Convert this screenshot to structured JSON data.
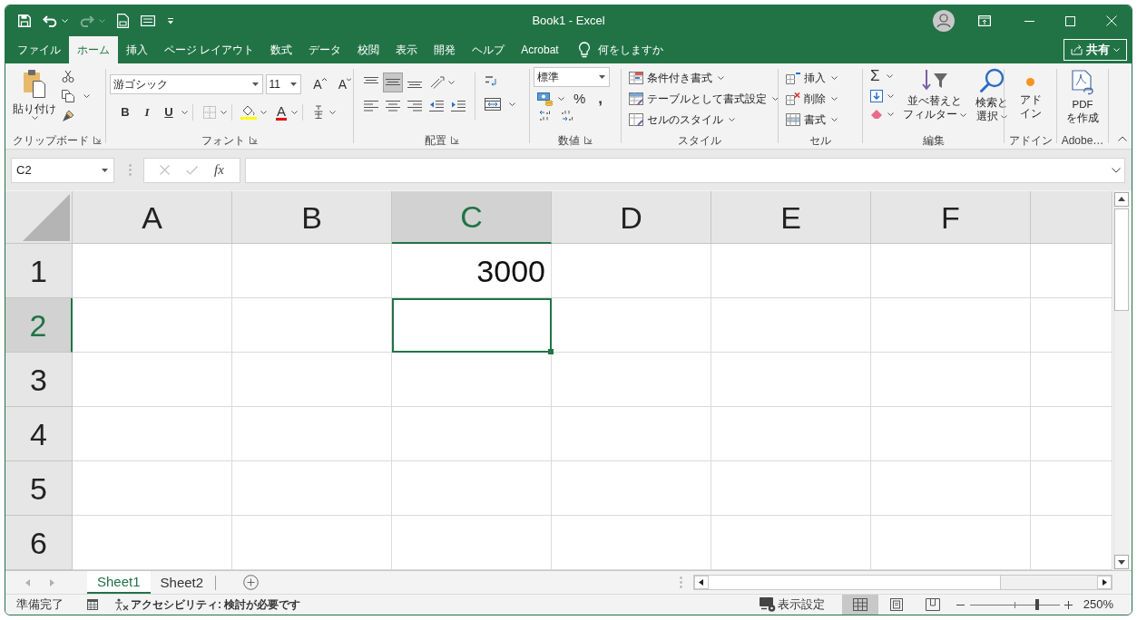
{
  "title_bar": {
    "quick_access": [
      {
        "kind": "save",
        "disabled": false
      },
      {
        "kind": "undo",
        "disabled": false
      },
      {
        "kind": "redo",
        "disabled": true
      },
      {
        "kind": "print_preview",
        "disabled": false
      },
      {
        "kind": "form",
        "disabled": false
      },
      {
        "kind": "customize",
        "disabled": false
      }
    ],
    "title": "Book1 - Excel"
  },
  "menu_tabs": [
    {
      "label": "ファイル",
      "selected": false
    },
    {
      "label": "ホーム",
      "selected": true
    },
    {
      "label": "挿入",
      "selected": false
    },
    {
      "label": "ページ レイアウト",
      "selected": false
    },
    {
      "label": "数式",
      "selected": false
    },
    {
      "label": "データ",
      "selected": false
    },
    {
      "label": "校閲",
      "selected": false
    },
    {
      "label": "表示",
      "selected": false
    },
    {
      "label": "開発",
      "selected": false
    },
    {
      "label": "ヘルプ",
      "selected": false
    },
    {
      "label": "Acrobat",
      "selected": false
    }
  ],
  "tell_me": {
    "text": "何をしますか"
  },
  "share_button": {
    "label": "共有"
  },
  "ribbon": {
    "groups": [
      {
        "kind": "clipboard",
        "label": "クリップボード",
        "launcher": true,
        "paste_label": "貼り付け"
      },
      {
        "kind": "font",
        "label": "フォント",
        "launcher": true,
        "font_name": "游ゴシック",
        "font_size": "11",
        "grow_label": "A",
        "shrink_label": "A",
        "style_buttons": [
          "B",
          "I",
          "U"
        ],
        "color_label": "A"
      },
      {
        "kind": "alignment",
        "label": "配置",
        "launcher": true,
        "vertical": [
          {
            "selected": false
          },
          {
            "selected": true
          },
          {
            "selected": false
          }
        ]
      },
      {
        "kind": "number",
        "label": "数値",
        "launcher": true,
        "format": "標準",
        "percent": "%",
        "comma": ","
      },
      {
        "kind": "styles",
        "label": "スタイル",
        "commands": [
          {
            "kind": "conditional",
            "label": "条件付き書式"
          },
          {
            "kind": "table",
            "label": "テーブルとして書式設定"
          },
          {
            "kind": "cell_styles",
            "label": "セルのスタイル"
          }
        ]
      },
      {
        "kind": "cells",
        "label": "セル",
        "commands": [
          {
            "kind": "insert",
            "label": "挿入"
          },
          {
            "kind": "delete",
            "label": "削除"
          },
          {
            "kind": "format",
            "label": "書式"
          }
        ]
      },
      {
        "kind": "editing",
        "label": "編集",
        "sum_symbol": "Σ",
        "sort_lines": [
          "並べ替えと",
          "フィルター"
        ],
        "find_lines": [
          "検索と",
          "選択"
        ]
      },
      {
        "kind": "addins",
        "label": "アドイン",
        "button_lines": [
          "アド",
          "イン"
        ]
      },
      {
        "kind": "adobe",
        "label": "Adobe…",
        "button_lines": [
          "PDF",
          "を作成"
        ]
      }
    ]
  },
  "formula_bar": {
    "name_box": "C2",
    "edit_buttons_disabled": true,
    "function_label": "fx"
  },
  "sheet": {
    "columns": [
      {
        "label": "A",
        "selected": false
      },
      {
        "label": "B",
        "selected": false
      },
      {
        "label": "C",
        "selected": true
      },
      {
        "label": "D",
        "selected": false
      },
      {
        "label": "E",
        "selected": false
      },
      {
        "label": "F",
        "selected": false
      },
      {
        "selected": false
      }
    ],
    "rows": [
      {
        "label": "1",
        "selected": false,
        "cells": [
          {
            "selected": false
          },
          {
            "selected": false
          },
          {
            "value": "3000",
            "selected": false
          },
          {
            "selected": false
          },
          {
            "selected": false
          },
          {
            "selected": false
          },
          {
            "selected": false
          }
        ]
      },
      {
        "label": "2",
        "selected": true,
        "cells": [
          {
            "selected": false
          },
          {
            "selected": false
          },
          {
            "selected": true
          },
          {
            "selected": false
          },
          {
            "selected": false
          },
          {
            "selected": false
          },
          {
            "selected": false
          }
        ]
      },
      {
        "label": "3",
        "selected": false,
        "cells": [
          {
            "selected": false
          },
          {
            "selected": false
          },
          {
            "selected": false
          },
          {
            "selected": false
          },
          {
            "selected": false
          },
          {
            "selected": false
          },
          {
            "selected": false
          }
        ]
      },
      {
        "label": "4",
        "selected": false,
        "cells": [
          {
            "selected": false
          },
          {
            "selected": false
          },
          {
            "selected": false
          },
          {
            "selected": false
          },
          {
            "selected": false
          },
          {
            "selected": false
          },
          {
            "selected": false
          }
        ]
      },
      {
        "label": "5",
        "selected": false,
        "cells": [
          {
            "selected": false
          },
          {
            "selected": false
          },
          {
            "selected": false
          },
          {
            "selected": false
          },
          {
            "selected": false
          },
          {
            "selected": false
          },
          {
            "selected": false
          }
        ]
      },
      {
        "label": "6",
        "selected": false,
        "cells": [
          {
            "selected": false
          },
          {
            "selected": false
          },
          {
            "selected": false
          },
          {
            "selected": false
          },
          {
            "selected": false
          },
          {
            "selected": false
          },
          {
            "selected": false
          }
        ]
      }
    ]
  },
  "sheet_bar": {
    "nav_disabled": true,
    "tabs": [
      {
        "label": "Sheet1",
        "selected": true
      },
      {
        "label": "Sheet2",
        "selected": false
      }
    ]
  },
  "status_bar": {
    "mode": "準備完了",
    "accessibility": "アクセシビリティ: 検討が必要です",
    "display_settings": "表示設定",
    "views": [
      {
        "kind": "normal",
        "selected": true
      },
      {
        "kind": "page_layout",
        "selected": false
      },
      {
        "kind": "page_break",
        "selected": false
      }
    ],
    "zoom": {
      "level": 0.75,
      "reading": "250%"
    }
  }
}
